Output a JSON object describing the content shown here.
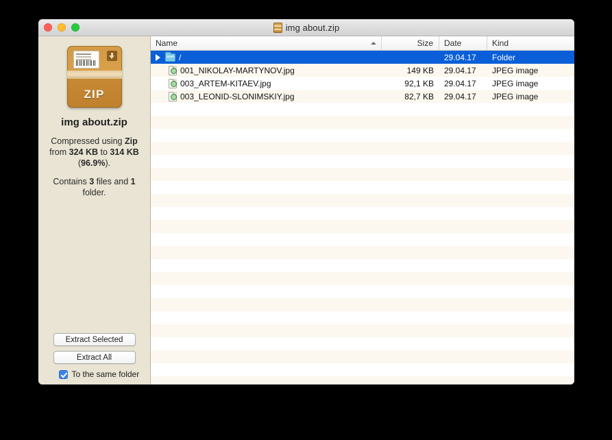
{
  "window": {
    "title": "img about.zip",
    "title_icon": "zip-file-icon",
    "controls": {
      "close": "close-button",
      "minimize": "minimize-button",
      "maximize": "maximize-button"
    }
  },
  "sidebar": {
    "archive_icon": "zip-archive-icon",
    "zip_icon_text": "ZIP",
    "file_name": "img about.zip",
    "compression_info": {
      "prefix": "Compressed using ",
      "method": "Zip",
      "middle": " from ",
      "original_size": "324 KB",
      "to": " to ",
      "compressed_size": "314 KB",
      "open_paren": " (",
      "ratio": "96.9%",
      "close_paren": ")."
    },
    "contents_info": {
      "prefix": "Contains ",
      "file_count": "3",
      "files_word": " files and ",
      "folder_count": "1",
      "folders_word": " folder."
    },
    "buttons": {
      "extract_selected": "Extract Selected",
      "extract_all": "Extract All"
    },
    "checkbox": {
      "label": "To the same folder",
      "checked": true
    }
  },
  "file_list": {
    "columns": [
      {
        "key": "name",
        "label": "Name",
        "sorted": true,
        "sort_direction": "ascending"
      },
      {
        "key": "size",
        "label": "Size",
        "sorted": false
      },
      {
        "key": "date",
        "label": "Date",
        "sorted": false
      },
      {
        "key": "kind",
        "label": "Kind",
        "sorted": false
      }
    ],
    "rows": [
      {
        "name": "/",
        "size": "",
        "date": "29.04.17",
        "kind": "Folder",
        "icon": "folder-icon",
        "selected": true,
        "expandable": true
      },
      {
        "name": "001_NIKOLAY-MARTYNOV.jpg",
        "size": "149 KB",
        "date": "29.04.17",
        "kind": "JPEG image",
        "icon": "jpeg-file-icon",
        "selected": false,
        "expandable": false
      },
      {
        "name": "003_ARTEM-KITAEV.jpg",
        "size": "92,1 KB",
        "date": "29.04.17",
        "kind": "JPEG image",
        "icon": "jpeg-file-icon",
        "selected": false,
        "expandable": false
      },
      {
        "name": "003_LEONID-SLONIMSKIY.jpg",
        "size": "82,7 KB",
        "date": "29.04.17",
        "kind": "JPEG image",
        "icon": "jpeg-file-icon",
        "selected": false,
        "expandable": false
      }
    ],
    "empty_row_count": 22
  },
  "colors": {
    "selection_blue": "#0a5fd8",
    "sidebar_beige": "#e9e4d3",
    "row_stripe": "#fcf8ef",
    "checkbox_blue": "#3b82e8",
    "desktop": "#000000"
  }
}
